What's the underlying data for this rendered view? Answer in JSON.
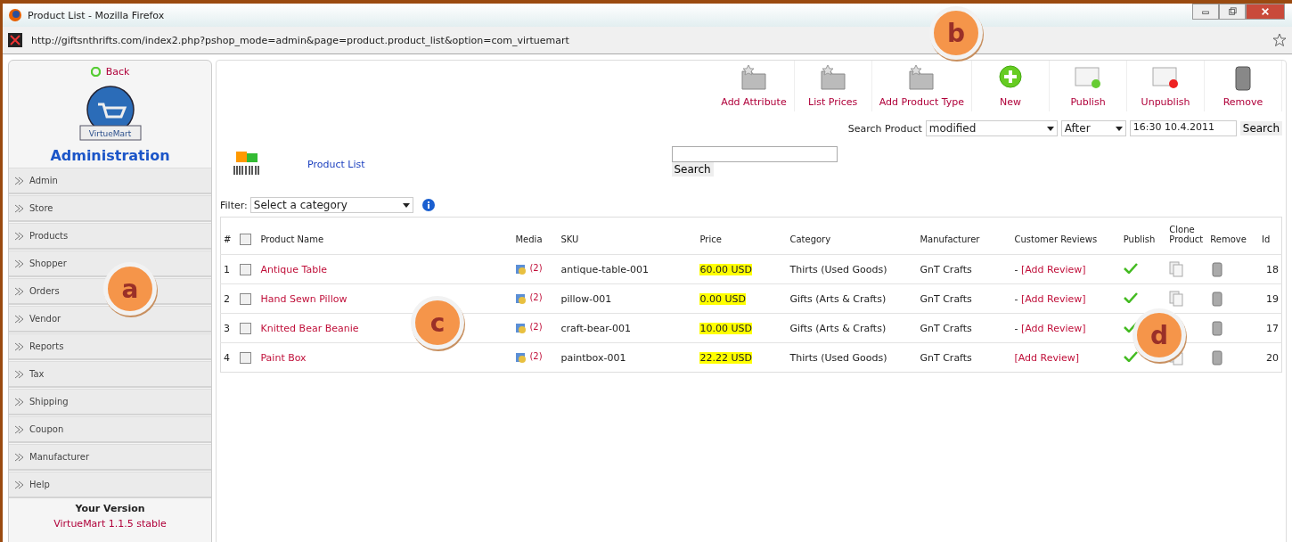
{
  "window": {
    "title": "Product List - Mozilla Firefox"
  },
  "address_bar": {
    "url": "http://giftsnthrifts.com/index2.php?pshop_mode=admin&page=product.product_list&option=com_virtuemart"
  },
  "sidebar": {
    "back": "Back",
    "logo_text": "VirtueMart",
    "heading": "Administration",
    "items": [
      {
        "label": "Admin"
      },
      {
        "label": "Store"
      },
      {
        "label": "Products"
      },
      {
        "label": "Shopper"
      },
      {
        "label": "Orders"
      },
      {
        "label": "Vendor"
      },
      {
        "label": "Reports"
      },
      {
        "label": "Tax"
      },
      {
        "label": "Shipping"
      },
      {
        "label": "Coupon"
      },
      {
        "label": "Manufacturer"
      },
      {
        "label": "Help"
      }
    ],
    "version_label": "Your Version",
    "version": "VirtueMart 1.1.5 stable"
  },
  "toolbar": [
    {
      "kind": "folder",
      "label": "Add Attribute"
    },
    {
      "kind": "folder",
      "label": "List Prices"
    },
    {
      "kind": "folder",
      "label": "Add Product Type"
    },
    {
      "kind": "new",
      "label": "New"
    },
    {
      "kind": "publish",
      "label": "Publish"
    },
    {
      "kind": "unpublish",
      "label": "Unpublish"
    },
    {
      "kind": "trash",
      "label": "Remove"
    }
  ],
  "search_product": {
    "label": "Search Product",
    "field": "modified",
    "condition": "After",
    "date": "16:30 10.4.2011",
    "button": "Search"
  },
  "page_title": "Product List",
  "keyword_search": {
    "button": "Search"
  },
  "filter": {
    "label": "Filter:",
    "value": "Select a category"
  },
  "table": {
    "select_all_checked": false,
    "columns": [
      "#",
      "Product Name",
      "Media",
      "SKU",
      "Price",
      "Category",
      "Manufacturer",
      "Customer Reviews",
      "Publish",
      "Clone Product",
      "Remove",
      "Id"
    ],
    "rows": [
      {
        "num": "1",
        "checked": false,
        "name": "Antique Table",
        "media": "(2)",
        "sku": "antique-table-001",
        "price": "60.00 USD",
        "category": "Thirts (Used Goods)",
        "manufacturer": "GnT Crafts",
        "review_prefix": "- ",
        "review": "[Add Review]",
        "published": true,
        "id": "18"
      },
      {
        "num": "2",
        "checked": false,
        "name": "Hand Sewn Pillow",
        "media": "(2)",
        "sku": "pillow-001",
        "price": "0.00 USD",
        "category": "Gifts (Arts & Crafts)",
        "manufacturer": "GnT Crafts",
        "review_prefix": "- ",
        "review": "[Add Review]",
        "published": true,
        "id": "19"
      },
      {
        "num": "3",
        "checked": false,
        "name": "Knitted Bear Beanie",
        "media": "(2)",
        "sku": "craft-bear-001",
        "price": "10.00 USD",
        "category": "Gifts (Arts & Crafts)",
        "manufacturer": "GnT Crafts",
        "review_prefix": "- ",
        "review": "[Add Review]",
        "published": true,
        "id": "17"
      },
      {
        "num": "4",
        "checked": false,
        "name": "Paint Box",
        "media": "(2)",
        "sku": "paintbox-001",
        "price": "22.22 USD",
        "category": "Thirts (Used Goods)",
        "manufacturer": "GnT Crafts",
        "review_prefix": "",
        "review": "[Add Review]",
        "published": true,
        "id": "20"
      }
    ]
  },
  "callouts": [
    {
      "label": "a"
    },
    {
      "label": "b"
    },
    {
      "label": "c"
    },
    {
      "label": "d"
    }
  ]
}
